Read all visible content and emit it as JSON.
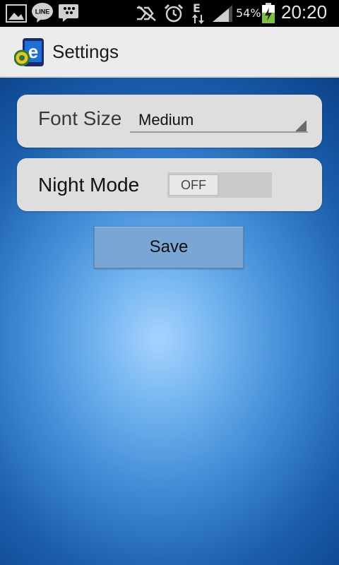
{
  "status_bar": {
    "battery_percent": "54%",
    "time": "20:20",
    "network_letter": "E",
    "line_badge": "LINE",
    "icons": [
      "gallery-icon",
      "line-icon",
      "bbm-icon",
      "nfc-mute-icon",
      "alarm-icon",
      "data-arrows-icon",
      "signal-icon",
      "battery-charging-icon"
    ],
    "accent_color": "#7fbf3f"
  },
  "action_bar": {
    "title": "Settings",
    "app_icon_letter": "e"
  },
  "settings": {
    "font_size_label": "Font Size",
    "font_size_value": "Medium",
    "night_mode_label": "Night Mode",
    "night_mode_state": "OFF"
  },
  "buttons": {
    "save": "Save"
  }
}
